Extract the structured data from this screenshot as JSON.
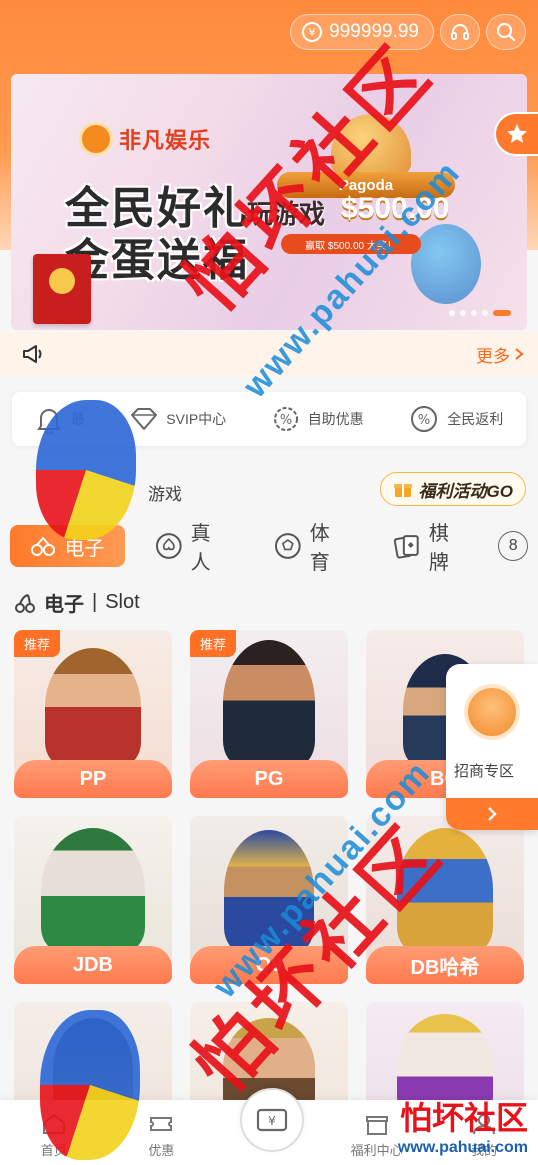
{
  "header": {
    "balance": "999999.99",
    "support_icon": "headset-icon",
    "search_icon": "search-icon"
  },
  "banner": {
    "brand": "非凡娱乐",
    "headline_1": "全民好礼",
    "headline_2": "金蛋送福",
    "promo_tag": "Pagoda",
    "promo_play": "玩游戏",
    "promo_amount": "$500.00",
    "promo_badge": "赢取 $500.00 大奖！",
    "page_count": 5,
    "active_page": 5
  },
  "notice": {
    "more_label": "更多"
  },
  "quick_actions": [
    {
      "label": "最",
      "icon": "bell-icon"
    },
    {
      "label": "SVIP中心",
      "icon": "diamond-icon"
    },
    {
      "label": "自助优惠",
      "icon": "percent-gear-icon"
    },
    {
      "label": "全民返利",
      "icon": "rebate-icon"
    }
  ],
  "promo_row": {
    "label": "游戏",
    "go_button": "福利活动GO"
  },
  "categories": [
    {
      "label": "电子",
      "active": true
    },
    {
      "label": "真人",
      "active": false
    },
    {
      "label": "体育",
      "active": false
    },
    {
      "label": "棋牌",
      "active": false
    }
  ],
  "category_more_count": "8",
  "section": {
    "title": "电子",
    "subtitle": "Slot"
  },
  "games": [
    {
      "name": "PP",
      "tag": "推荐"
    },
    {
      "name": "PG",
      "tag": "推荐"
    },
    {
      "name": "BG",
      "tag": ""
    },
    {
      "name": "JDB",
      "tag": ""
    },
    {
      "name": "Q9",
      "tag": ""
    },
    {
      "name": "DB哈希",
      "tag": ""
    },
    {
      "name": "",
      "tag": ""
    },
    {
      "name": "",
      "tag": ""
    },
    {
      "name": "",
      "tag": ""
    }
  ],
  "side_float": {
    "label": "招商专区"
  },
  "tabbar": [
    {
      "label": "首页"
    },
    {
      "label": "优惠"
    },
    {
      "label": ""
    },
    {
      "label": "福利中心"
    },
    {
      "label": "我的"
    }
  ],
  "watermark": {
    "text": "怕坏社区",
    "url": "www.pahuai.com"
  },
  "colors": {
    "accent": "#ff7a2c",
    "watermark_red": "#e8121a",
    "watermark_blue": "#1a8cd8"
  }
}
